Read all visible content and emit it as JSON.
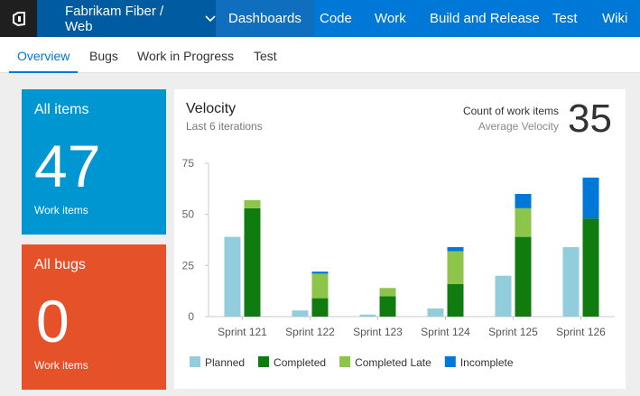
{
  "topnav": {
    "project": "Fabrikam Fiber / Web",
    "items": [
      "Dashboards",
      "Code",
      "Work",
      "Build and Release",
      "Test",
      "Wiki"
    ],
    "active": "Dashboards"
  },
  "subnav": {
    "items": [
      "Overview",
      "Bugs",
      "Work in Progress",
      "Test"
    ],
    "active": "Overview"
  },
  "tiles": {
    "all_items": {
      "title": "All items",
      "count": "47",
      "footer": "Work items",
      "color": "#0096d1"
    },
    "all_bugs": {
      "title": "All bugs",
      "count": "0",
      "footer": "Work items",
      "color": "#e55128"
    }
  },
  "velocity": {
    "title": "Velocity",
    "subtitle": "Last 6 iterations",
    "count_label": "Count of work items",
    "avg_label": "Average Velocity",
    "avg_value": "35"
  },
  "chart_data": {
    "type": "bar",
    "categories": [
      "Sprint 121",
      "Sprint 122",
      "Sprint 123",
      "Sprint 124",
      "Sprint 125",
      "Sprint 126"
    ],
    "ylim": [
      0,
      75
    ],
    "yticks": [
      0,
      25,
      50,
      75
    ],
    "grid": false,
    "legend": "bottom",
    "series": [
      {
        "name": "Planned",
        "color": "#92cddc",
        "values": [
          39,
          3,
          1,
          4,
          20,
          34
        ]
      },
      {
        "name": "Completed",
        "color": "#107c10",
        "values": [
          53,
          9,
          10,
          16,
          39,
          48
        ]
      },
      {
        "name": "Completed Late",
        "color": "#8dc54b",
        "values": [
          4,
          12,
          4,
          16,
          14,
          0
        ]
      },
      {
        "name": "Incomplete",
        "color": "#0078d7",
        "values": [
          0,
          1,
          0,
          2,
          7,
          20
        ]
      }
    ]
  }
}
